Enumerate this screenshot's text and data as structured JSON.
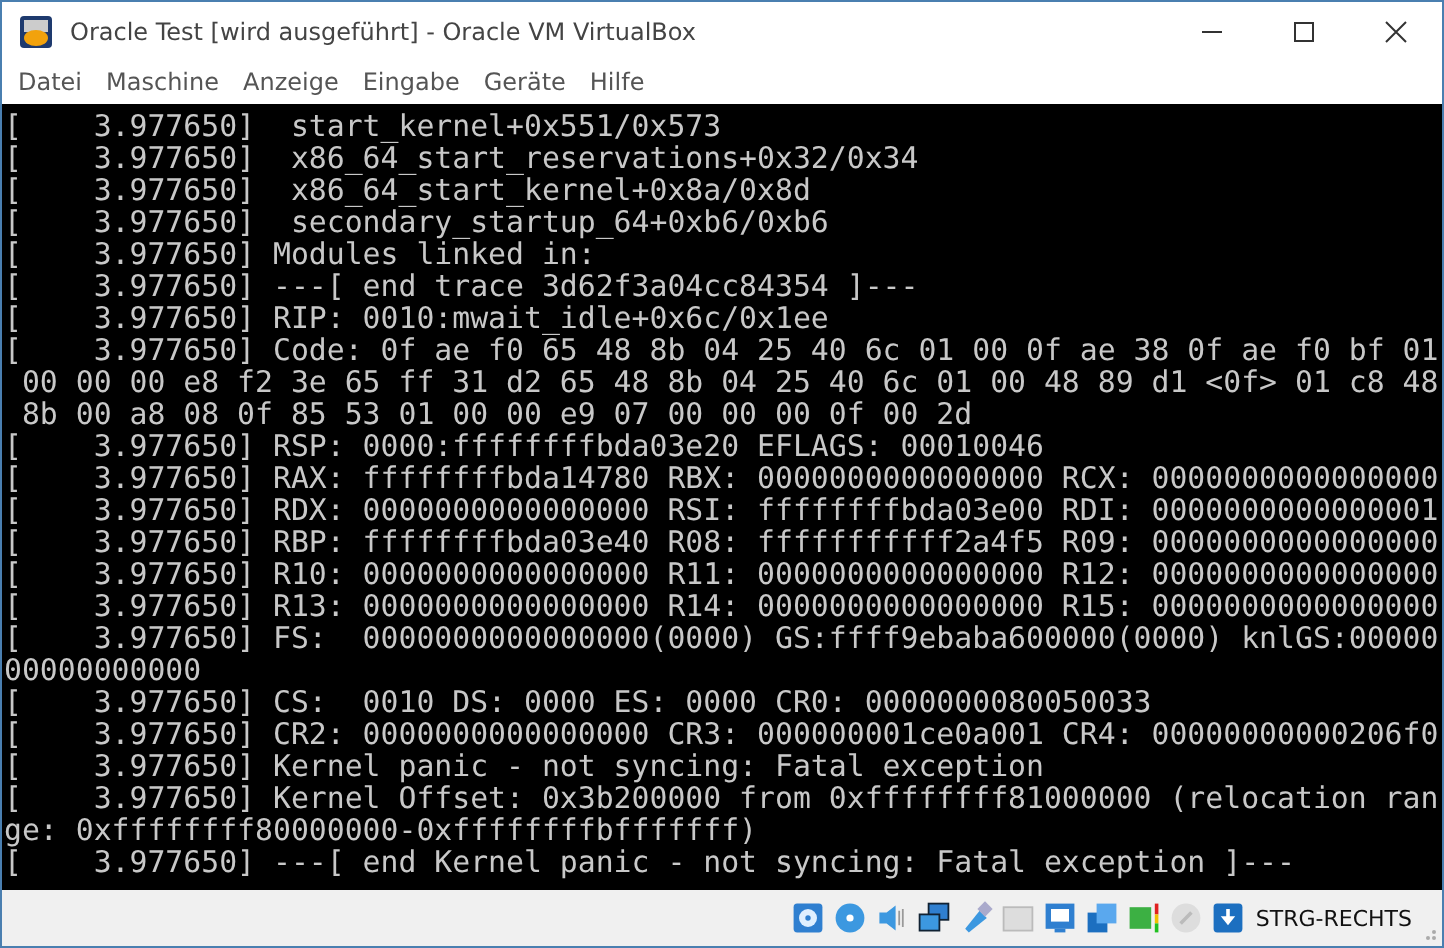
{
  "window": {
    "title": "Oracle Test [wird ausgeführt] - Oracle VM VirtualBox"
  },
  "menu": [
    "Datei",
    "Maschine",
    "Anzeige",
    "Eingabe",
    "Geräte",
    "Hilfe"
  ],
  "console": {
    "lines": [
      "[    3.977650]  start_kernel+0x551/0x573",
      "[    3.977650]  x86_64_start_reservations+0x32/0x34",
      "[    3.977650]  x86_64_start_kernel+0x8a/0x8d",
      "[    3.977650]  secondary_startup_64+0xb6/0xb6",
      "[    3.977650] Modules linked in:",
      "[    3.977650] ---[ end trace 3d62f3a04cc84354 ]---",
      "[    3.977650] RIP: 0010:mwait_idle+0x6c/0x1ee",
      "[    3.977650] Code: 0f ae f0 65 48 8b 04 25 40 6c 01 00 0f ae 38 0f ae f0 bf 01",
      " 00 00 00 e8 f2 3e 65 ff 31 d2 65 48 8b 04 25 40 6c 01 00 48 89 d1 <0f> 01 c8 48",
      " 8b 00 a8 08 0f 85 53 01 00 00 e9 07 00 00 00 0f 00 2d",
      "[    3.977650] RSP: 0000:ffffffffbda03e20 EFLAGS: 00010046",
      "[    3.977650] RAX: ffffffffbda14780 RBX: 0000000000000000 RCX: 0000000000000000",
      "[    3.977650] RDX: 0000000000000000 RSI: ffffffffbda03e00 RDI: 0000000000000001",
      "[    3.977650] RBP: ffffffffbda03e40 R08: fffffffffff2a4f5 R09: 0000000000000000",
      "[    3.977650] R10: 0000000000000000 R11: 0000000000000000 R12: 0000000000000000",
      "[    3.977650] R13: 0000000000000000 R14: 0000000000000000 R15: 0000000000000000",
      "[    3.977650] FS:  0000000000000000(0000) GS:ffff9ebaba600000(0000) knlGS:00000",
      "00000000000",
      "[    3.977650] CS:  0010 DS: 0000 ES: 0000 CR0: 0000000080050033",
      "[    3.977650] CR2: 0000000000000000 CR3: 000000001ce0a001 CR4: 00000000000206f0",
      "[    3.977650] Kernel panic - not syncing: Fatal exception",
      "[    3.977650] Kernel Offset: 0x3b200000 from 0xffffffff81000000 (relocation ran",
      "ge: 0xffffffff80000000-0xffffffffbfffffff)",
      "[    3.977650] ---[ end Kernel panic - not syncing: Fatal exception ]---"
    ]
  },
  "status_bar": {
    "host_key": "STRG-RECHTS"
  }
}
